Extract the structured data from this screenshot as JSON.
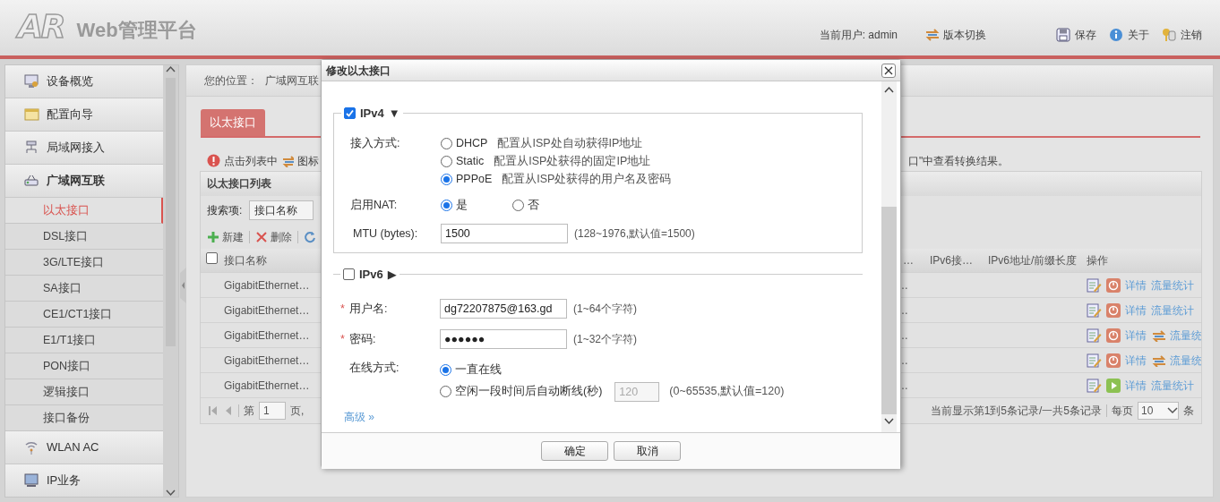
{
  "header": {
    "logo": "AR",
    "title": "Web管理平台",
    "user": "当前用户: admin",
    "links": [
      {
        "kind": "switch",
        "label": "版本切换"
      },
      {
        "kind": "save",
        "label": "保存"
      },
      {
        "kind": "about",
        "label": "关于"
      },
      {
        "kind": "logout",
        "label": "注销"
      }
    ]
  },
  "sidebar": {
    "items": [
      {
        "label": "设备概览",
        "kind": "overview",
        "expanded": false
      },
      {
        "label": "配置向导",
        "kind": "wizard",
        "expanded": false
      },
      {
        "label": "局域网接入",
        "kind": "lan",
        "expanded": false
      },
      {
        "label": "广域网互联",
        "kind": "wan",
        "expanded": true,
        "children": [
          {
            "label": "以太接口",
            "selected": true
          },
          {
            "label": "DSL接口",
            "selected": false
          },
          {
            "label": "3G/LTE接口",
            "selected": false
          },
          {
            "label": "SA接口",
            "selected": false
          },
          {
            "label": "CE1/CT1接口",
            "selected": false
          },
          {
            "label": "E1/T1接口",
            "selected": false
          },
          {
            "label": "PON接口",
            "selected": false
          },
          {
            "label": "逻辑接口",
            "selected": false
          },
          {
            "label": "接口备份",
            "selected": false
          }
        ]
      },
      {
        "label": "WLAN AC",
        "kind": "wlan",
        "expanded": false
      },
      {
        "label": "IP业务",
        "kind": "ip",
        "expanded": false
      }
    ]
  },
  "breadcrumb": {
    "label": "您的位置：",
    "path": "广域网互联"
  },
  "tabs": [
    {
      "label": "以太接口",
      "selected": true
    }
  ],
  "notice": {
    "left": "点击列表中",
    "mid": "图标",
    "right": "口\"中查看转换结果。"
  },
  "list": {
    "title": "以太接口列表",
    "search_label": "搜索项:",
    "search_value": "接口名称",
    "toolbar": [
      {
        "kind": "add",
        "label": "新建"
      },
      {
        "kind": "delete",
        "label": "删除"
      },
      {
        "kind": "refresh"
      }
    ],
    "select_all_checked": false,
    "columns": [
      "接口名称",
      "…",
      "IPv6接…",
      "IPv6地址/前缀长度",
      "操作"
    ],
    "rows": [
      {
        "name": "GigabitEthernet…",
        "column_2": "…",
        "kind": "stop",
        "swap": false,
        "details": "详情",
        "stats": "流量统计"
      },
      {
        "name": "GigabitEthernet…",
        "column_2": "…",
        "kind": "stop",
        "swap": false,
        "details": "详情",
        "stats": "流量统计"
      },
      {
        "name": "GigabitEthernet…",
        "column_2": "…",
        "kind": "stop",
        "swap": true,
        "details": "详情",
        "stats": "流量统"
      },
      {
        "name": "GigabitEthernet…",
        "column_2": "…",
        "kind": "stop",
        "swap": true,
        "details": "详情",
        "stats": "流量统"
      },
      {
        "name": "GigabitEthernet…",
        "column_2": "…",
        "kind": "start",
        "swap": false,
        "details": "详情",
        "stats": "流量统计"
      }
    ],
    "pagination": {
      "page_prefix": "第",
      "page": "1",
      "page_suffix": "页,",
      "summary": "当前显示第1到5条记录/一共5条记录",
      "per_page_label": "每页",
      "per_page": "10",
      "unit": "条"
    }
  },
  "dialog": {
    "title": "修改以太接口",
    "sections": [
      {
        "label": "IPv4",
        "checked": true,
        "expanded": true,
        "toggle": "▼",
        "access": {
          "label": "接入方式:",
          "options": [
            {
              "label": "DHCP",
              "hint": "配置从ISP处自动获得IP地址",
              "selected": false
            },
            {
              "label": "Static",
              "hint": "配置从ISP处获得的固定IP地址",
              "selected": false
            },
            {
              "label": "PPPoE",
              "hint": "配置从ISP处获得的用户名及密码",
              "selected": true
            }
          ]
        },
        "nat": {
          "label": "启用NAT:",
          "options": [
            {
              "label": "是",
              "selected": true
            },
            {
              "label": "否",
              "selected": false
            }
          ]
        },
        "mtu": {
          "label": "MTU (bytes):",
          "value": "1500",
          "hint": "(128~1976,默认值=1500)"
        }
      },
      {
        "label": "IPv6",
        "checked": false,
        "expanded": false,
        "toggle": "▶"
      }
    ],
    "fields": [
      {
        "marker": "*",
        "label": "用户名:",
        "value": "dg72207875@163.gd",
        "hint": "(1~64个字符)"
      },
      {
        "marker": "*",
        "label": "密码:",
        "value": "●●●●●●",
        "hint": "(1~32个字符)"
      }
    ],
    "online": {
      "label": "在线方式:",
      "options": [
        {
          "label": "一直在线",
          "selected": true
        },
        {
          "label": "空闲一段时间后自动断线(秒)",
          "selected": false
        }
      ],
      "idle": {
        "value": "120",
        "disabled": true,
        "hint": "(0~65535,默认值=120)"
      }
    },
    "advanced": "高级 »",
    "buttons": [
      {
        "label": "确定"
      },
      {
        "label": "取消"
      }
    ]
  }
}
